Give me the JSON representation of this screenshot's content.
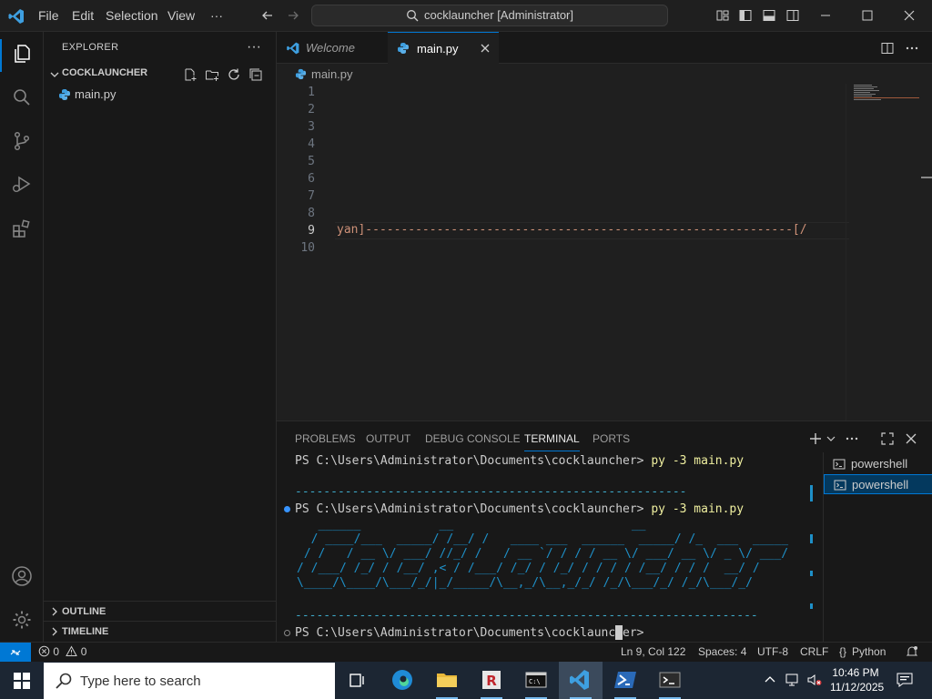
{
  "titlebar": {
    "menu": [
      "File",
      "Edit",
      "Selection",
      "View",
      "···"
    ],
    "command_center": "cocklauncher [Administrator]"
  },
  "sidebar": {
    "title": "EXPLORER",
    "more": "···",
    "folder": "COCKLAUNCHER",
    "file": "main.py",
    "outline": "OUTLINE",
    "timeline": "TIMELINE"
  },
  "editor": {
    "tabs": [
      {
        "label": "Welcome",
        "active": false
      },
      {
        "label": "main.py",
        "active": true
      }
    ],
    "breadcrumb": "main.py",
    "line_numbers": [
      "1",
      "2",
      "3",
      "4",
      "5",
      "6",
      "7",
      "8",
      "9",
      "10"
    ],
    "current_line": "9",
    "line9_text": "yan]------------------------------------------------------------[/"
  },
  "panel": {
    "tabs": [
      "PROBLEMS",
      "OUTPUT",
      "DEBUG CONSOLE",
      "TERMINAL",
      "PORTS"
    ],
    "active_tab": "TERMINAL",
    "terminal": {
      "prompt": "PS C:\\Users\\Administrator\\Documents\\cocklauncher>",
      "command": "py -3 main.py",
      "dashes_short": "-------------------------------------------------------",
      "dashes_long": "-----------------------------------------------------------------",
      "ascii_art": "   ______           __                         __\n  / ____/___  _____/ /__/ /   ____ ___  ______  _____/ /_  ___  _____\n / /   / __ \\/ ___/ //_/ /   / __ `/ / / / __ \\/ ___/ __ \\/ _ \\/ ___/\n/ /___/ /_/ / /__/ ,< / /___/ /_/ / /_/ / / / / /__/ / / /  __/ /\n\\____/\\____/\\___/_/|_/_____/\\__,_/\\__,_/_/ /_/\\___/_/ /_/\\___/_/"
    },
    "terminals": [
      "powershell",
      "powershell"
    ]
  },
  "statusbar": {
    "problems": "0",
    "warnings": "0",
    "position": "Ln 9, Col 122",
    "spaces": "Spaces: 4",
    "encoding": "UTF-8",
    "eol": "CRLF",
    "language": "Python"
  },
  "taskbar": {
    "search_placeholder": "Type here to search",
    "time": "10:46 PM",
    "date": "11/12/2025"
  },
  "colors": {
    "accent": "#0078d4",
    "editor_bg": "#1f1f1f",
    "sidebar_bg": "#181818",
    "ascii": "#1e90c8",
    "taskbar": "#1c2633"
  }
}
